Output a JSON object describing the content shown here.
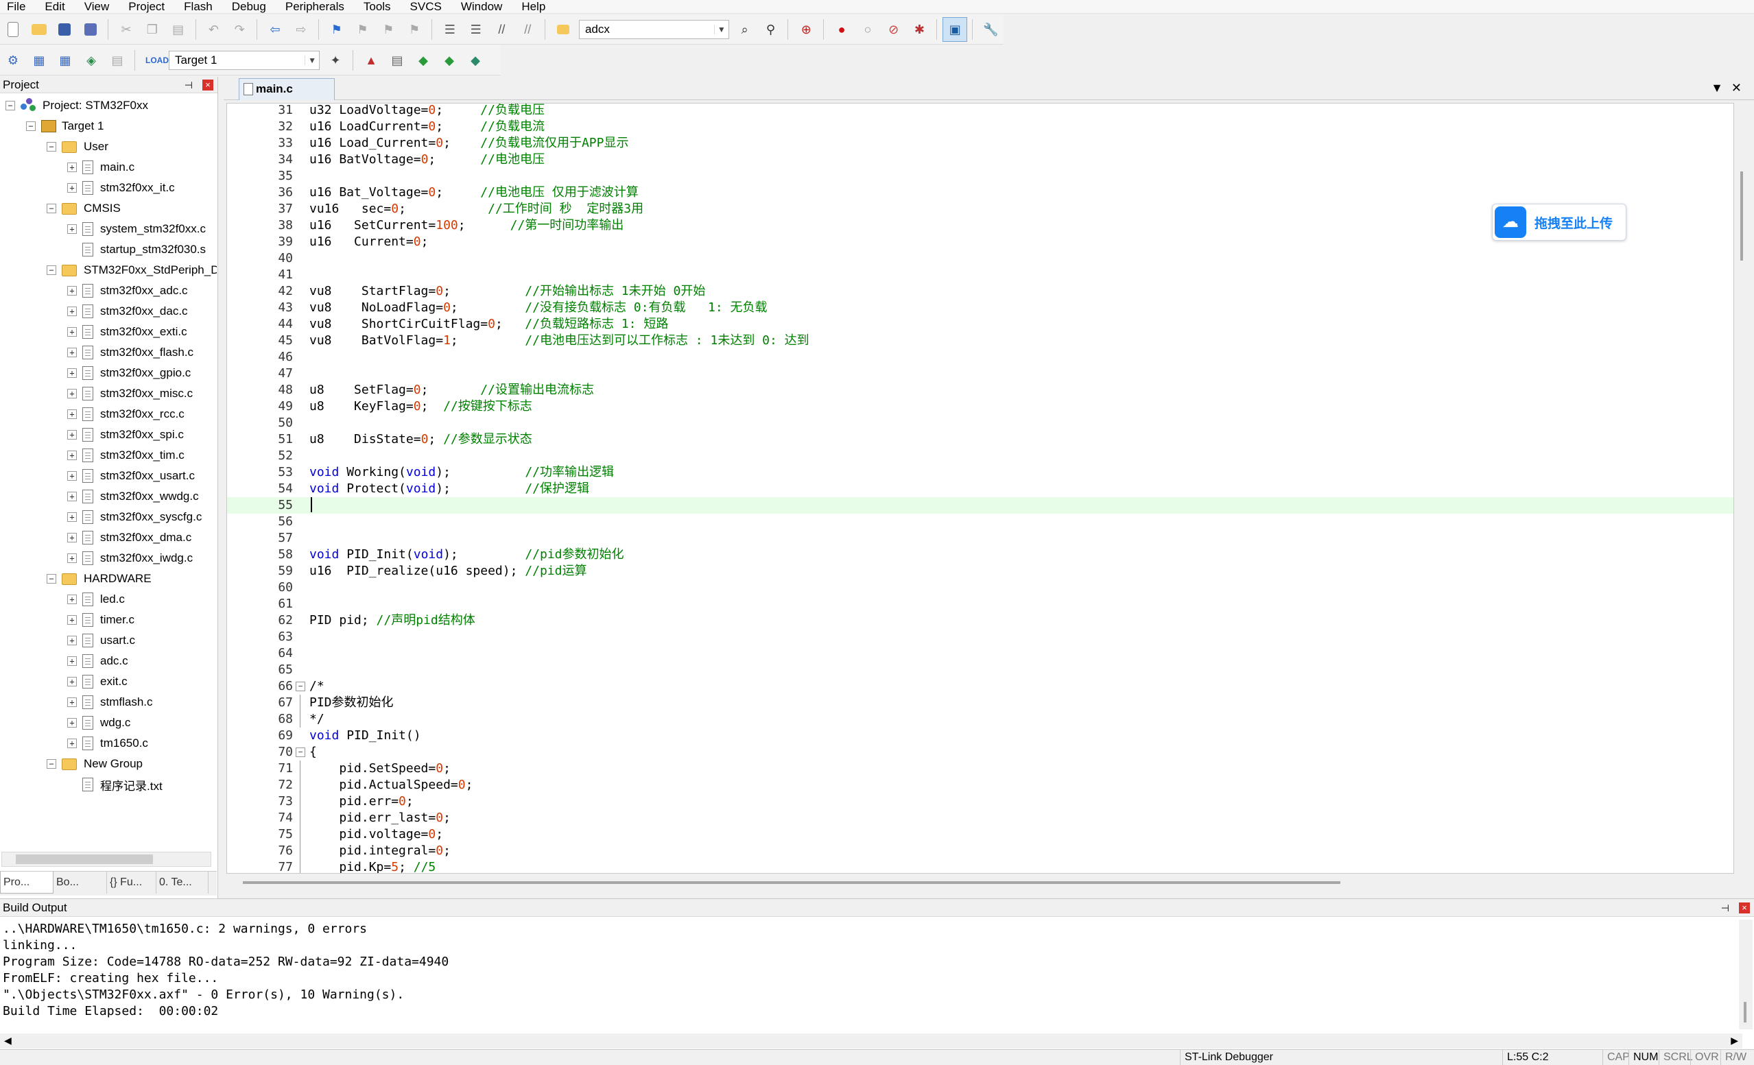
{
  "menu": [
    "File",
    "Edit",
    "View",
    "Project",
    "Flash",
    "Debug",
    "Peripherals",
    "Tools",
    "SVCS",
    "Window",
    "Help"
  ],
  "toolbar": {
    "find_value": "adcx",
    "target_value": "Target 1"
  },
  "project_panel": {
    "title": "Project",
    "tree": [
      {
        "label": "Project: STM32F0xx",
        "level": 0,
        "kind": "project"
      },
      {
        "label": "Target 1",
        "level": 1,
        "kind": "target"
      },
      {
        "label": "User",
        "level": 2,
        "kind": "folder"
      },
      {
        "label": "main.c",
        "level": 3,
        "kind": "file"
      },
      {
        "label": "stm32f0xx_it.c",
        "level": 3,
        "kind": "file"
      },
      {
        "label": "CMSIS",
        "level": 2,
        "kind": "folder"
      },
      {
        "label": "system_stm32f0xx.c",
        "level": 3,
        "kind": "file"
      },
      {
        "label": "startup_stm32f030.s",
        "level": 3,
        "kind": "file-noexp"
      },
      {
        "label": "STM32F0xx_StdPeriph_D",
        "level": 2,
        "kind": "folder"
      },
      {
        "label": "stm32f0xx_adc.c",
        "level": 3,
        "kind": "file"
      },
      {
        "label": "stm32f0xx_dac.c",
        "level": 3,
        "kind": "file"
      },
      {
        "label": "stm32f0xx_exti.c",
        "level": 3,
        "kind": "file"
      },
      {
        "label": "stm32f0xx_flash.c",
        "level": 3,
        "kind": "file"
      },
      {
        "label": "stm32f0xx_gpio.c",
        "level": 3,
        "kind": "file"
      },
      {
        "label": "stm32f0xx_misc.c",
        "level": 3,
        "kind": "file"
      },
      {
        "label": "stm32f0xx_rcc.c",
        "level": 3,
        "kind": "file"
      },
      {
        "label": "stm32f0xx_spi.c",
        "level": 3,
        "kind": "file"
      },
      {
        "label": "stm32f0xx_tim.c",
        "level": 3,
        "kind": "file"
      },
      {
        "label": "stm32f0xx_usart.c",
        "level": 3,
        "kind": "file"
      },
      {
        "label": "stm32f0xx_wwdg.c",
        "level": 3,
        "kind": "file"
      },
      {
        "label": "stm32f0xx_syscfg.c",
        "level": 3,
        "kind": "file"
      },
      {
        "label": "stm32f0xx_dma.c",
        "level": 3,
        "kind": "file"
      },
      {
        "label": "stm32f0xx_iwdg.c",
        "level": 3,
        "kind": "file"
      },
      {
        "label": "HARDWARE",
        "level": 2,
        "kind": "folder"
      },
      {
        "label": "led.c",
        "level": 3,
        "kind": "file"
      },
      {
        "label": "timer.c",
        "level": 3,
        "kind": "file"
      },
      {
        "label": "usart.c",
        "level": 3,
        "kind": "file"
      },
      {
        "label": "adc.c",
        "level": 3,
        "kind": "file"
      },
      {
        "label": "exit.c",
        "level": 3,
        "kind": "file"
      },
      {
        "label": "stmflash.c",
        "level": 3,
        "kind": "file"
      },
      {
        "label": "wdg.c",
        "level": 3,
        "kind": "file"
      },
      {
        "label": "tm1650.c",
        "level": 3,
        "kind": "file"
      },
      {
        "label": "New Group",
        "level": 2,
        "kind": "folder"
      },
      {
        "label": "程序记录.txt",
        "level": 3,
        "kind": "file-noexp"
      }
    ],
    "tabs": [
      "Pro...",
      "Bo...",
      "{} Fu...",
      "0. Te..."
    ]
  },
  "editor": {
    "tab": "main.c",
    "current_line": 55,
    "lines": [
      {
        "n": "31",
        "code": "u32 LoadVoltage=0;     //负载电压"
      },
      {
        "n": "32",
        "code": "u16 LoadCurrent=0;     //负载电流"
      },
      {
        "n": "33",
        "code": "u16 Load_Current=0;    //负载电流仅用于APP显示"
      },
      {
        "n": "34",
        "code": "u16 BatVoltage=0;      //电池电压"
      },
      {
        "n": "35",
        "code": ""
      },
      {
        "n": "36",
        "code": "u16 Bat_Voltage=0;     //电池电压 仅用于滤波计算"
      },
      {
        "n": "37",
        "code": "vu16   sec=0;           //工作时间 秒  定时器3用"
      },
      {
        "n": "38",
        "code": "u16   SetCurrent=100;      //第一时间功率输出"
      },
      {
        "n": "39",
        "code": "u16   Current=0;"
      },
      {
        "n": "40",
        "code": ""
      },
      {
        "n": "41",
        "code": ""
      },
      {
        "n": "42",
        "code": "vu8    StartFlag=0;          //开始输出标志 1未开始 0开始"
      },
      {
        "n": "43",
        "code": "vu8    NoLoadFlag=0;         //没有接负载标志 0:有负载   1: 无负载"
      },
      {
        "n": "44",
        "code": "vu8    ShortCirCuitFlag=0;   //负载短路标志 1: 短路"
      },
      {
        "n": "45",
        "code": "vu8    BatVolFlag=1;         //电池电压达到可以工作标志 : 1未达到 0: 达到"
      },
      {
        "n": "46",
        "code": ""
      },
      {
        "n": "47",
        "code": ""
      },
      {
        "n": "48",
        "code": "u8    SetFlag=0;       //设置输出电流标志"
      },
      {
        "n": "49",
        "code": "u8    KeyFlag=0;  //按键按下标志"
      },
      {
        "n": "50",
        "code": ""
      },
      {
        "n": "51",
        "code": "u8    DisState=0; //参数显示状态"
      },
      {
        "n": "52",
        "code": ""
      },
      {
        "n": "53",
        "code": "void Working(void);          //功率输出逻辑"
      },
      {
        "n": "54",
        "code": "void Protect(void);          //保护逻辑"
      },
      {
        "n": "55",
        "code": ""
      },
      {
        "n": "56",
        "code": ""
      },
      {
        "n": "57",
        "code": ""
      },
      {
        "n": "58",
        "code": "void PID_Init(void);         //pid参数初始化"
      },
      {
        "n": "59",
        "code": "u16  PID_realize(u16 speed); //pid运算"
      },
      {
        "n": "60",
        "code": ""
      },
      {
        "n": "61",
        "code": ""
      },
      {
        "n": "62",
        "code": "PID pid; //声明pid结构体"
      },
      {
        "n": "63",
        "code": ""
      },
      {
        "n": "64",
        "code": ""
      },
      {
        "n": "65",
        "code": ""
      },
      {
        "n": "66",
        "code": "/*"
      },
      {
        "n": "67",
        "code": "PID参数初始化"
      },
      {
        "n": "68",
        "code": "*/"
      },
      {
        "n": "69",
        "code": "void PID_Init()"
      },
      {
        "n": "70",
        "code": "{"
      },
      {
        "n": "71",
        "code": "    pid.SetSpeed=0;"
      },
      {
        "n": "72",
        "code": "    pid.ActualSpeed=0;"
      },
      {
        "n": "73",
        "code": "    pid.err=0;"
      },
      {
        "n": "74",
        "code": "    pid.err_last=0;"
      },
      {
        "n": "75",
        "code": "    pid.voltage=0;"
      },
      {
        "n": "76",
        "code": "    pid.integral=0;"
      },
      {
        "n": "77",
        "code": "    pid.Kp=5; //5"
      }
    ]
  },
  "upload_widget": {
    "label": "拖拽至此上传"
  },
  "build_output": {
    "title": "Build Output",
    "lines": [
      "..\\HARDWARE\\TM1650\\tm1650.c: 2 warnings, 0 errors",
      "linking...",
      "Program Size: Code=14788 RO-data=252 RW-data=92 ZI-data=4940",
      "FromELF: creating hex file...",
      "\".\\Objects\\STM32F0xx.axf\" - 0 Error(s), 10 Warning(s).",
      "Build Time Elapsed:  00:00:02"
    ]
  },
  "statusbar": {
    "debugger": "ST-Link Debugger",
    "position": "L:55 C:2",
    "cap": "CAP",
    "num": "NUM",
    "scrl": "SCRL",
    "ovr": "OVR",
    "rw": "R/W"
  },
  "colors": {
    "keyword": "#0000e0",
    "comment": "#008000",
    "number": "#d83b01",
    "current_line": "#e8fde8",
    "accent": "#1681f5"
  }
}
